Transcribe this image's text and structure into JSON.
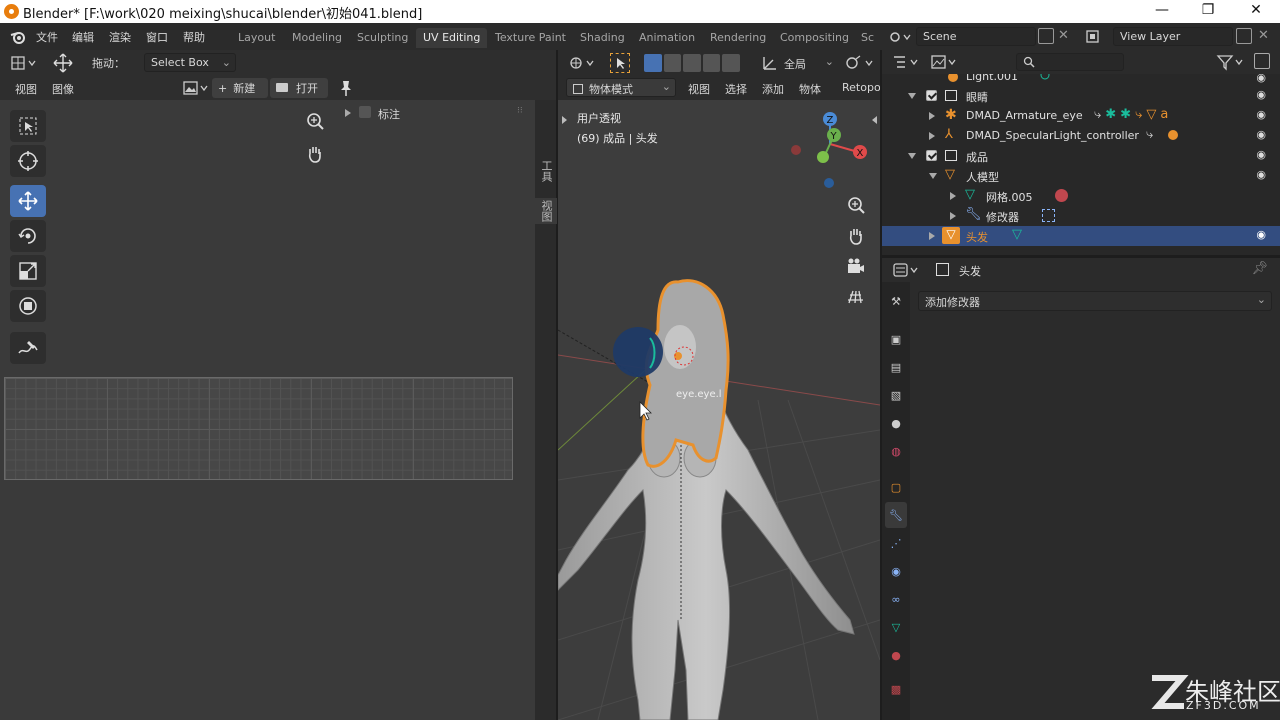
{
  "window": {
    "title": "Blender* [F:\\work\\020 meixing\\shucai\\blender\\初始041.blend]",
    "controls": {
      "minimize": "—",
      "maximize": "❐",
      "close": "✕"
    }
  },
  "menu": {
    "items": [
      "文件",
      "编辑",
      "渲染",
      "窗口",
      "帮助"
    ]
  },
  "workspaces": {
    "tabs": [
      "Layout",
      "Modeling",
      "Sculpting",
      "UV Editing",
      "Texture Paint",
      "Shading",
      "Animation",
      "Rendering",
      "Compositing",
      "Sc"
    ],
    "active": "UV Editing"
  },
  "scene": {
    "label": "Scene",
    "view_layer": "View Layer"
  },
  "uv_editor": {
    "drag_label": "拖动：",
    "select_mode": "Select Box",
    "menu_view": "视图",
    "menu_image": "图像",
    "new_label": "新建",
    "open_label": "打开",
    "annotation_label": "标注",
    "side_tabs": [
      "工具",
      "视图"
    ]
  },
  "viewport": {
    "mode": "物体模式",
    "menus": [
      "视图",
      "选择",
      "添加",
      "物体",
      "Retopol"
    ],
    "transform_orientation": "全局",
    "view_name": "用户透视",
    "object_info": "(69) 成品 | 头发",
    "label_on_model": "eye.eye.l",
    "gizmo_axes": {
      "z": "Z",
      "y": "Y",
      "x": "X"
    }
  },
  "outliner": {
    "rows": [
      {
        "label": "Light.001",
        "depth": 2,
        "icon": "light-icon"
      },
      {
        "label": "眼睛",
        "depth": 1,
        "icon": "collection-icon",
        "expanded": true
      },
      {
        "label": "DMAD_Armature_eye",
        "depth": 2,
        "icon": "armature-icon"
      },
      {
        "label": "DMAD_SpecularLight_controller",
        "depth": 2,
        "icon": "empty-icon"
      },
      {
        "label": "成品",
        "depth": 1,
        "icon": "collection-icon",
        "expanded": true
      },
      {
        "label": "人模型",
        "depth": 2,
        "icon": "mesh-object-icon"
      },
      {
        "label": "网格.005",
        "depth": 3,
        "icon": "mesh-data-icon"
      },
      {
        "label": "修改器",
        "depth": 3,
        "icon": "wrench-icon"
      },
      {
        "label": "头发",
        "depth": 2,
        "icon": "mesh-object-icon",
        "selected": true
      }
    ]
  },
  "properties": {
    "object_name": "头发",
    "add_modifier": "添加修改器",
    "tabs": [
      "tool-icon",
      "render-icon",
      "output-icon",
      "view-layer-icon",
      "scene-icon",
      "world-icon",
      "object-icon",
      "modifier-icon",
      "particles-icon",
      "physics-icon",
      "constraints-icon",
      "data-icon",
      "material-icon",
      "texture-icon"
    ],
    "active_tab": "modifier-icon"
  },
  "watermark": {
    "brand": "朱峰社区",
    "site": "ZF3D.COM"
  },
  "colors": {
    "accent": "#4772b3",
    "selection": "#334d80",
    "object_orange": "#e8912e"
  }
}
